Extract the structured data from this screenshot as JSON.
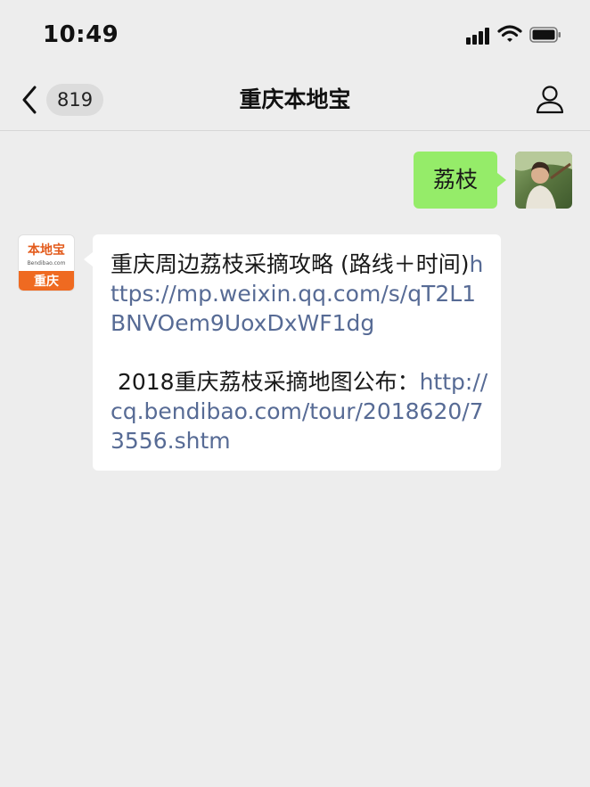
{
  "status_bar": {
    "time": "10:49",
    "icons": [
      "signal-icon",
      "wifi-icon",
      "battery-icon"
    ]
  },
  "nav": {
    "back_icon": "chevron-left-icon",
    "unread_count": "819",
    "title": "重庆本地宝",
    "profile_icon": "person-icon"
  },
  "messages": {
    "outgoing": {
      "text": "荔枝",
      "bubble_color": "#95ec69"
    },
    "incoming": {
      "avatar": {
        "top_text": "本地宝",
        "url_text": "Bendibao.com",
        "bottom_text": "重庆",
        "brand_color": "#ef6a21"
      },
      "part1_text": "重庆周边荔枝采摘攻略 (路线＋时间)",
      "part1_link": "https://mp.weixin.qq.com/s/qT2L1BNVOem9UoxDxWF1dg",
      "part2_text": " 2018重庆荔枝采摘地图公布：",
      "part2_link": "http://cq.bendibao.com/tour/2018620/73556.shtm",
      "link_color": "#576b95"
    }
  },
  "colors": {
    "background": "#ededed",
    "text": "#191919"
  }
}
